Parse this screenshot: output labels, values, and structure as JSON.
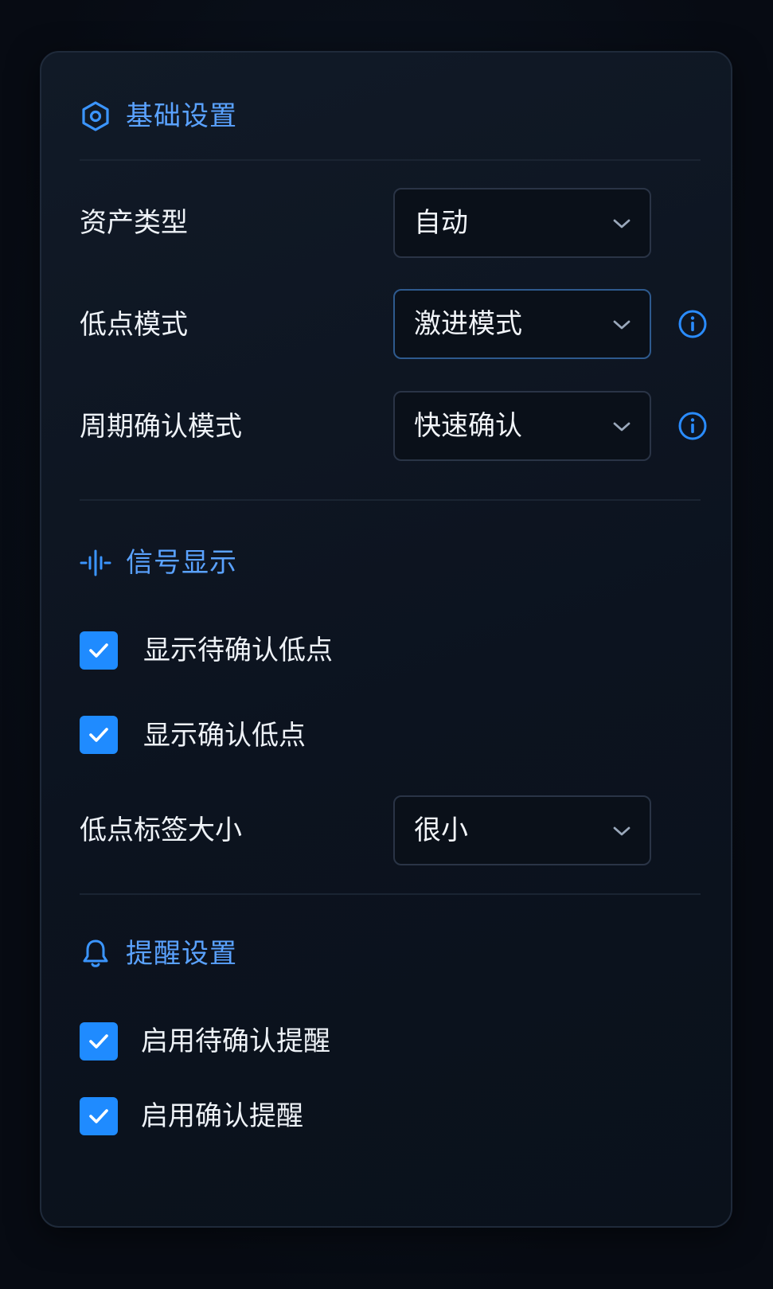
{
  "sections": {
    "basic": {
      "title": "基础设置",
      "icon": "hexagon-settings-icon",
      "asset_type": {
        "label": "资产类型",
        "value": "自动"
      },
      "low_mode": {
        "label": "低点模式",
        "value": "激进模式"
      },
      "cycle_confirm_mode": {
        "label": "周期确认模式",
        "value": "快速确认"
      }
    },
    "signal": {
      "title": "信号显示",
      "icon": "signal-wave-icon",
      "show_pending_low": {
        "label": "显示待确认低点",
        "checked": true
      },
      "show_confirmed_low": {
        "label": "显示确认低点",
        "checked": true
      },
      "label_size": {
        "label": "低点标签大小",
        "value": "很小"
      }
    },
    "alert": {
      "title": "提醒设置",
      "icon": "bell-icon",
      "enable_pending_alert": {
        "label": "启用待确认提醒",
        "checked": true
      },
      "enable_confirmed_alert": {
        "label": "启用确认提醒",
        "checked": true
      }
    }
  },
  "colors": {
    "accent": "#1f8bff",
    "section_title": "#5aa2ff",
    "text": "#eef2f7",
    "panel_border": "#1f2a3a"
  }
}
